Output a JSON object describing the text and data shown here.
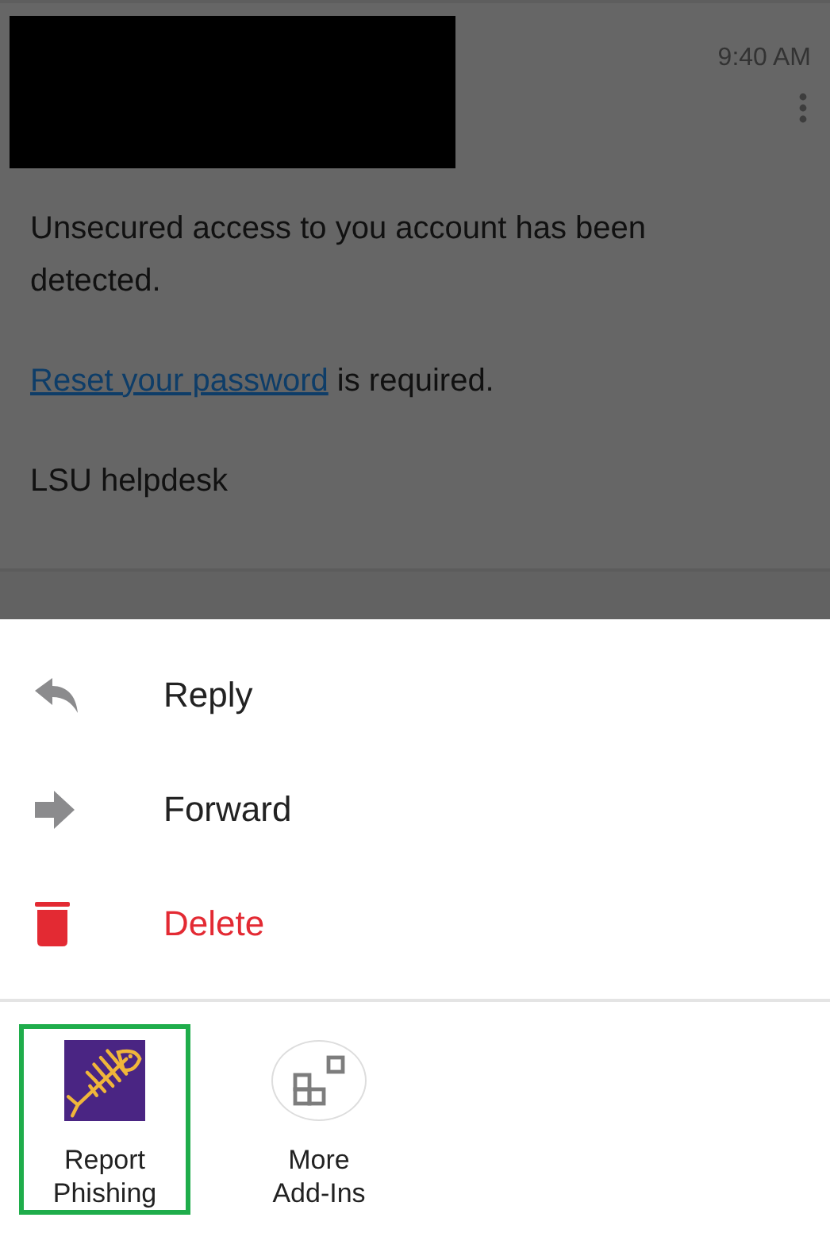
{
  "message": {
    "time": "9:40 AM",
    "body": [
      {
        "text": "Unsecured access to you account has been detected."
      },
      {
        "link": "Reset your password",
        "text": "is required."
      },
      {
        "text": "LSU helpdesk"
      }
    ]
  },
  "actions": [
    {
      "kind": "reply",
      "label": "Reply"
    },
    {
      "kind": "forward",
      "label": "Forward"
    },
    {
      "kind": "delete",
      "label": "Delete"
    }
  ],
  "addins": [
    {
      "kind": "phishing",
      "label": "Report Phishing",
      "selected": true
    },
    {
      "kind": "more",
      "label": "More Add-Ins",
      "selected": false
    }
  ]
}
